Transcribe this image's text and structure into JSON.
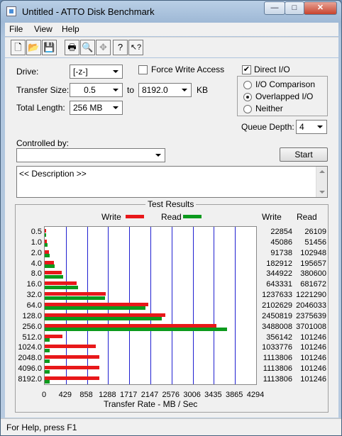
{
  "window": {
    "title": "Untitled - ATTO Disk Benchmark",
    "minimize": "—",
    "maximize": "□",
    "close": "✕"
  },
  "menu": [
    "File",
    "View",
    "Help"
  ],
  "toolbar": [
    {
      "icon": "new-document-icon",
      "glyph": "🗋"
    },
    {
      "icon": "open-folder-icon",
      "glyph": "📂"
    },
    {
      "icon": "save-icon",
      "glyph": "💾"
    },
    {
      "icon": "print-icon",
      "glyph": "🖶"
    },
    {
      "icon": "print-preview-icon",
      "glyph": "🔍"
    },
    {
      "icon": "move-icon",
      "glyph": "✥"
    },
    {
      "icon": "help-icon",
      "glyph": "?"
    },
    {
      "icon": "context-help-icon",
      "glyph": "↖?"
    }
  ],
  "form": {
    "drive_label": "Drive:",
    "drive_value": "[-z-]",
    "force_write_label": "Force Write Access",
    "force_write_checked": false,
    "direct_io_label": "Direct I/O",
    "direct_io_checked": true,
    "direct_io_mark": "✔",
    "transfer_size_label": "Transfer Size:",
    "transfer_from": "0.5",
    "to_label": "to",
    "transfer_to": "8192.0",
    "kb_label": "KB",
    "total_length_label": "Total Length:",
    "total_length_value": "256 MB",
    "io_options": [
      {
        "label": "I/O Comparison",
        "selected": false
      },
      {
        "label": "Overlapped I/O",
        "selected": true
      },
      {
        "label": "Neither",
        "selected": false
      }
    ],
    "queue_depth_label": "Queue Depth:",
    "queue_depth_value": "4",
    "controlled_by_label": "Controlled by:",
    "controlled_by_value": "",
    "start_label": "Start",
    "description": "<< Description >>"
  },
  "results": {
    "title": "Test Results",
    "write_legend": "Write",
    "read_legend": "Read",
    "write_col": "Write",
    "read_col": "Read"
  },
  "colors": {
    "write": "#e8181a",
    "read": "#0c9a1d",
    "grid": "#1f1fd1"
  },
  "chart_data": {
    "type": "bar",
    "orientation": "horizontal",
    "title": "Test Results",
    "xlabel": "Transfer Rate - MB / Sec",
    "xlim": [
      0,
      4294
    ],
    "x_ticks": [
      "0",
      "429",
      "858",
      "1288",
      "1717",
      "2147",
      "2576",
      "3006",
      "3435",
      "3865",
      "4294"
    ],
    "categories": [
      "0.5",
      "1.0",
      "2.0",
      "4.0",
      "8.0",
      "16.0",
      "32.0",
      "64.0",
      "128.0",
      "256.0",
      "512.0",
      "1024.0",
      "2048.0",
      "4096.0",
      "8192.0"
    ],
    "series": [
      {
        "name": "Write",
        "values": [
          22854,
          45086,
          91738,
          182912,
          344922,
          643331,
          1237633,
          2102629,
          2450819,
          3488008,
          356142,
          1033776,
          1113806,
          1113806,
          1113806
        ]
      },
      {
        "name": "Read",
        "values": [
          26109,
          51456,
          102948,
          195657,
          380600,
          681672,
          1221290,
          2046033,
          2375639,
          3701008,
          101246,
          101246,
          101246,
          101246,
          101246
        ]
      }
    ],
    "value_scale": 1000,
    "grid": true,
    "legend": "top"
  },
  "status": "For Help, press F1"
}
